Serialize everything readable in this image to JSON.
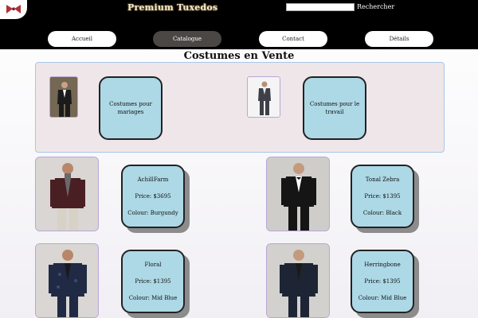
{
  "header": {
    "site_title": "Premium Tuxedos",
    "search_label": "Rechercher",
    "search_value": ""
  },
  "nav": [
    {
      "label": "Accueil",
      "active": false
    },
    {
      "label": "Catalogue",
      "active": true
    },
    {
      "label": "Contact",
      "active": false
    },
    {
      "label": "Détails",
      "active": false
    }
  ],
  "section_title": "Costumes en Vente",
  "categories": [
    {
      "label": "Costumes pour mariages"
    },
    {
      "label": "Costumes pour le travail"
    }
  ],
  "products": [
    {
      "name": "AchillFarm",
      "price": "Price: $3695",
      "colour": "Colour: Burgundy",
      "jacket": "#4a1f24",
      "shirt": "#6a6a6a",
      "pants": "#d8d2c6",
      "bg": "#d9d6d3"
    },
    {
      "name": "Tonal Zebra",
      "price": "Price: $1395",
      "colour": "Colour: Black",
      "jacket": "#151515",
      "shirt": "#ffffff",
      "pants": "#151515",
      "bg": "#cfcdca"
    },
    {
      "name": "Floral",
      "price": "Price: $1395",
      "colour": "Colour: Mid Blue",
      "jacket": "#202a44",
      "shirt": "#1a1a1a",
      "pants": "#202a44",
      "bg": "#d9d6d3"
    },
    {
      "name": "Herringbone",
      "price": "Price: $1395",
      "colour": "Colour: Mid Blue",
      "jacket": "#1d2535",
      "shirt": "#1a1a1a",
      "pants": "#1d2535",
      "bg": "#d3d1ce"
    }
  ],
  "colors": {
    "header_bg": "#000000",
    "card_bg": "#add8e6",
    "panel_bg": "#efe6e9",
    "nav_active": "#4a4744"
  }
}
